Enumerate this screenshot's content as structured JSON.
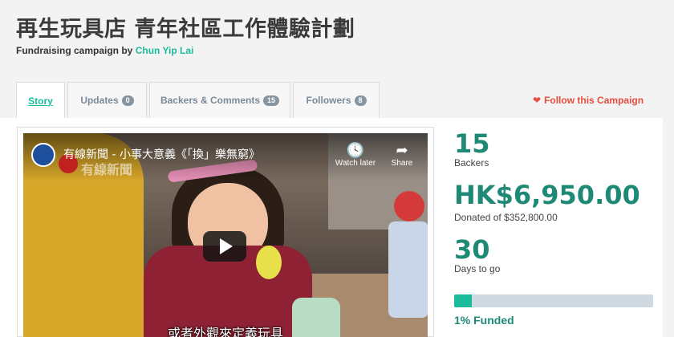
{
  "campaign": {
    "title": "再生玩具店 青年社區工作體驗計劃",
    "byline_prefix": "Fundraising campaign by",
    "creator": "Chun Yip Lai"
  },
  "tabs": [
    {
      "label": "Story",
      "count": null,
      "active": true
    },
    {
      "label": "Updates",
      "count": "0",
      "active": false
    },
    {
      "label": "Backers & Comments",
      "count": "15",
      "active": false
    },
    {
      "label": "Followers",
      "count": "8",
      "active": false
    }
  ],
  "follow": {
    "label": "Follow this Campaign",
    "icon": "heart-icon"
  },
  "video": {
    "title": "有線新聞 - 小事大意義《「換」樂無窮》",
    "channel_watermark": "有線新聞",
    "watch_later_label": "Watch later",
    "share_label": "Share",
    "subtitle": "或者外觀來定義玩具"
  },
  "stats": {
    "backers_value": "15",
    "backers_label": "Backers",
    "donated_value": "HK$6,950.00",
    "donated_label": "Donated of $352,800.00",
    "days_value": "30",
    "days_label": "Days to go",
    "funded_label": "1% Funded",
    "funded_fraction": 0.09
  },
  "colors": {
    "accent": "#1abc9c",
    "stat_green": "#1e8a76",
    "follow_red": "#e74c3c",
    "progress_track": "#cfd9e2"
  }
}
